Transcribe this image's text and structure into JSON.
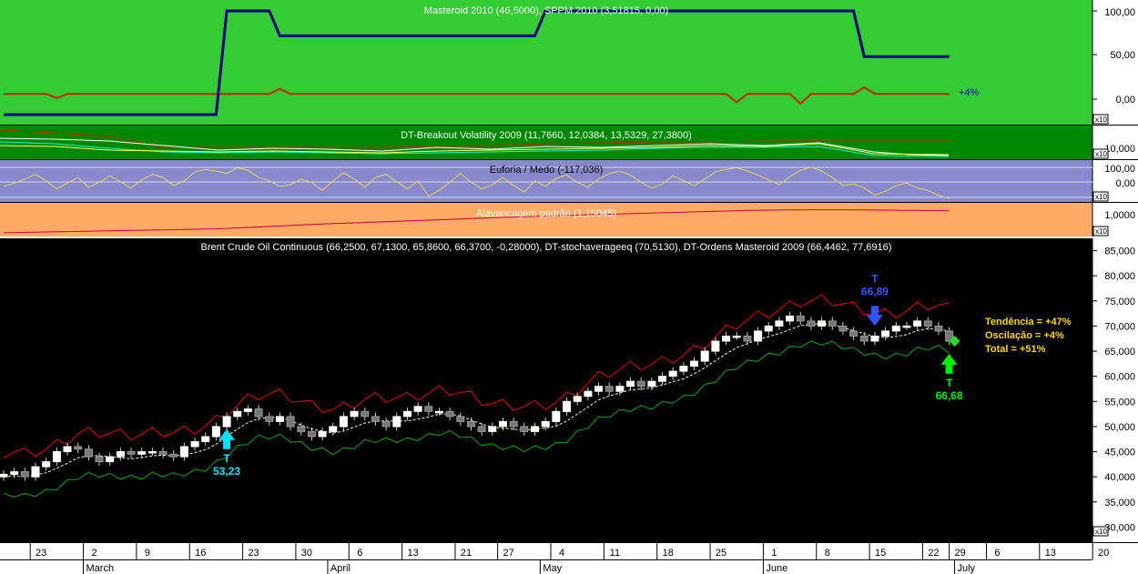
{
  "panels": {
    "masteroid": {
      "title": "Masteroid 2010 (46,5000), SPPM 2010 (3,51815, 0,00)",
      "ticks": [
        "100,00",
        "50,00",
        "0,00"
      ],
      "badge": "x10",
      "annotation": "+4%",
      "colors": {
        "bg": "#33cc33",
        "line": "#000080",
        "signal": "#cc2200"
      }
    },
    "breakout": {
      "title": "DT-Breakout Volatility 2009 (11,7660, 12,0384, 13,5329, 27,3800)",
      "ticks": [
        "10,000"
      ],
      "badge": "x10",
      "colors": {
        "bg": "#008800"
      }
    },
    "euforia": {
      "title": "Euforia / Medo (-117,036)",
      "ticks": [
        "100,00",
        "0,00"
      ],
      "badge": "x10",
      "colors": {
        "bg": "#8888cc",
        "line": "#e8d85a"
      }
    },
    "alavancagem": {
      "title": "Alavancagem padrão (1,15045)",
      "ticks": [
        "1,0000"
      ],
      "badge": "x10",
      "colors": {
        "bg": "#ffaa66",
        "line": "#cc0033"
      }
    },
    "price": {
      "title": "Brent Crude Oil Continuous (66,2500, 67,1300, 65,8600, 66,3700, -0,28000), DT-stochaverageeq (70,5130), DT-Ordens Masteroid 2009 (66,4462, 77,6916)",
      "badge": "x10",
      "signals": [
        {
          "label": "T",
          "value": "53,23",
          "color": "#00e5ff",
          "dir": "up",
          "at": 21,
          "y": 45.5
        },
        {
          "label": "T",
          "value": "66,89",
          "color": "#3355ff",
          "dir": "down",
          "at": 82,
          "y": 74
        },
        {
          "label": "T",
          "value": "66,68",
          "color": "#00ee00",
          "dir": "up",
          "at": 89,
          "y": 60.5
        }
      ],
      "stats": [
        "Tendência = +47%",
        "Oscilação = +4%",
        "Total = +51%"
      ]
    }
  },
  "x_axis": {
    "days": [
      {
        "label": "23",
        "at": 2.5
      },
      {
        "label": "2",
        "at": 7.5
      },
      {
        "label": "9",
        "at": 12.5
      },
      {
        "label": "16",
        "at": 17.5
      },
      {
        "label": "23",
        "at": 22.5
      },
      {
        "label": "30",
        "at": 27.5
      },
      {
        "label": "6",
        "at": 32.5
      },
      {
        "label": "13",
        "at": 37.5
      },
      {
        "label": "21",
        "at": 42.5
      },
      {
        "label": "27",
        "at": 46.5
      },
      {
        "label": "4",
        "at": 51.5
      },
      {
        "label": "11",
        "at": 56.5
      },
      {
        "label": "18",
        "at": 61.5
      },
      {
        "label": "25",
        "at": 66.5
      },
      {
        "label": "1",
        "at": 71.5
      },
      {
        "label": "8",
        "at": 76.5
      },
      {
        "label": "15",
        "at": 81.5
      },
      {
        "label": "22",
        "at": 86.5
      },
      {
        "label": "29",
        "at": 89
      },
      {
        "label": "6",
        "at": 92.5
      },
      {
        "label": "13",
        "at": 97.5
      },
      {
        "label": "20",
        "at": 102.5
      }
    ],
    "months": [
      {
        "label": "March",
        "at": 7.5
      },
      {
        "label": "April",
        "at": 30.5
      },
      {
        "label": "May",
        "at": 50.5
      },
      {
        "label": "June",
        "at": 71.5
      },
      {
        "label": "July",
        "at": 89.5
      }
    ]
  },
  "chart_data": [
    {
      "type": "line",
      "title": "Masteroid 2010 (46,5000), SPPM 2010 (3,51815, 0,00)",
      "ylim": [
        -25,
        120
      ],
      "series": [
        {
          "name": "Masteroid 2010",
          "values": [
            -25,
            -25,
            -25,
            -25,
            -25,
            -25,
            -25,
            -25,
            -25,
            -25,
            -25,
            -25,
            -25,
            -25,
            -25,
            -25,
            -25,
            -25,
            -25,
            -25,
            -25,
            100,
            100,
            100,
            100,
            100,
            70,
            70,
            70,
            70,
            70,
            70,
            70,
            70,
            70,
            70,
            70,
            70,
            70,
            70,
            70,
            70,
            70,
            70,
            70,
            70,
            70,
            70,
            70,
            70,
            70,
            100,
            100,
            100,
            100,
            100,
            100,
            100,
            100,
            100,
            100,
            100,
            100,
            100,
            100,
            100,
            100,
            100,
            100,
            100,
            100,
            100,
            100,
            100,
            100,
            100,
            100,
            100,
            100,
            100,
            100,
            45,
            45,
            45,
            45,
            45,
            45,
            45,
            45,
            45
          ]
        },
        {
          "name": "SPPM 2010",
          "values": [
            0,
            0,
            0,
            0,
            0,
            -5,
            0,
            0,
            0,
            0,
            0,
            0,
            0,
            0,
            0,
            0,
            0,
            0,
            0,
            0,
            0,
            0,
            0,
            0,
            0,
            0,
            6,
            0,
            0,
            0,
            0,
            0,
            0,
            0,
            0,
            0,
            0,
            0,
            0,
            0,
            0,
            0,
            0,
            0,
            0,
            0,
            0,
            0,
            0,
            0,
            0,
            0,
            0,
            0,
            0,
            0,
            0,
            0,
            0,
            0,
            0,
            0,
            0,
            0,
            0,
            0,
            0,
            0,
            0,
            -10,
            0,
            0,
            0,
            0,
            0,
            -12,
            0,
            0,
            0,
            0,
            0,
            8,
            0,
            0,
            0,
            0,
            0,
            0,
            0,
            0
          ]
        }
      ]
    },
    {
      "type": "line",
      "title": "Euforia / Medo (-117,036)",
      "ylim": [
        -200,
        250
      ],
      "series": [
        {
          "name": "Euforia / Medo",
          "values": [
            -30,
            10,
            60,
            120,
            40,
            -60,
            10,
            80,
            -40,
            20,
            100,
            30,
            -50,
            50,
            120,
            80,
            -20,
            40,
            150,
            180,
            160,
            130,
            200,
            170,
            80,
            40,
            -30,
            -10,
            60,
            20,
            -80,
            40,
            140,
            60,
            -40,
            80,
            120,
            30,
            -60,
            40,
            -150,
            -80,
            20,
            130,
            20,
            -60,
            -10,
            80,
            -20,
            -100,
            40,
            -30,
            70,
            110,
            20,
            -40,
            60,
            130,
            160,
            110,
            20,
            -50,
            0,
            100,
            40,
            -20,
            60,
            150,
            180,
            200,
            160,
            110,
            50,
            -10,
            90,
            170,
            210,
            160,
            80,
            -20,
            0,
            -50,
            -140,
            -90,
            -20,
            10,
            -50,
            -80,
            -140,
            -180
          ]
        }
      ]
    },
    {
      "type": "line",
      "title": "Alavancagem padrão (1,15045)",
      "ylim": [
        -1.0,
        2.0
      ],
      "series": [
        {
          "name": "Alavancagem padrão",
          "values": [
            -0.8,
            -0.78,
            -0.76,
            -0.74,
            -0.72,
            -0.7,
            -0.68,
            -0.66,
            -0.64,
            -0.62,
            -0.6,
            -0.58,
            -0.56,
            -0.54,
            -0.52,
            -0.5,
            -0.48,
            -0.46,
            -0.44,
            -0.42,
            -0.4,
            -0.35,
            -0.3,
            -0.25,
            -0.2,
            -0.15,
            -0.1,
            -0.05,
            0,
            0.05,
            0.1,
            0.14,
            0.18,
            0.22,
            0.26,
            0.3,
            0.34,
            0.38,
            0.42,
            0.46,
            0.5,
            0.54,
            0.58,
            0.62,
            0.66,
            0.7,
            0.74,
            0.78,
            0.82,
            0.86,
            0.9,
            0.93,
            0.96,
            0.99,
            1.02,
            1.05,
            1.08,
            1.11,
            1.14,
            1.17,
            1.2,
            1.23,
            1.26,
            1.29,
            1.32,
            1.35,
            1.38,
            1.41,
            1.44,
            1.47,
            1.5,
            1.52,
            1.53,
            1.54,
            1.55,
            1.56,
            1.57,
            1.57,
            1.57,
            1.57,
            1.56,
            1.55,
            1.54,
            1.53,
            1.52,
            1.51,
            1.5,
            1.49,
            1.48,
            1.47
          ]
        }
      ]
    },
    {
      "type": "candlestick",
      "title": "Brent Crude Oil Continuous (66,2500, 67,1300, 65,8600, 66,3700, -0,28000), DT-stochaverageeq (70,5130), DT-Ordens Masteroid 2009 (66,4462, 77,6916)",
      "ylim": [
        27,
        86
      ],
      "yticks": [
        30,
        35,
        40,
        45,
        50,
        55,
        60,
        65,
        70,
        75,
        80,
        85
      ],
      "ytick_labels": [
        "30,000",
        "35,000",
        "40,000",
        "45,000",
        "50,000",
        "55,000",
        "60,000",
        "65,000",
        "70,000",
        "75,000",
        "80,000",
        "85,000"
      ],
      "close": [
        40.5,
        41,
        40,
        42,
        43,
        45,
        46,
        45.5,
        44,
        43,
        44,
        45,
        44.5,
        45,
        45,
        44.5,
        44,
        46,
        47,
        48,
        50,
        52,
        53,
        53.5,
        52,
        51,
        52,
        50,
        49,
        48,
        49,
        50,
        52,
        53,
        52,
        51,
        50,
        52,
        53,
        54,
        53,
        53,
        52,
        51,
        50,
        49,
        50,
        51,
        50,
        49,
        50,
        51,
        53,
        55,
        56,
        57,
        58,
        57,
        58,
        59,
        58,
        59,
        60,
        61,
        62,
        63,
        65,
        67,
        68,
        68,
        67,
        69,
        70,
        71,
        72,
        71,
        70,
        71,
        70,
        69,
        68,
        67,
        68,
        69,
        70,
        70,
        71,
        70,
        69,
        67
      ]
    }
  ]
}
